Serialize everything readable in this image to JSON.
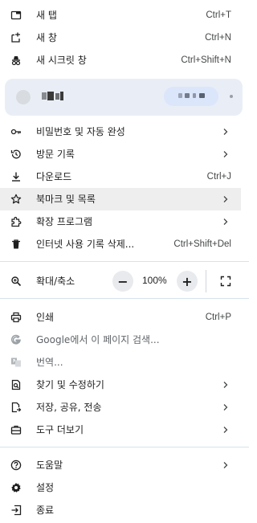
{
  "menu": {
    "new_tab": {
      "label": "새 탭",
      "shortcut": "Ctrl+T",
      "icon": "new-tab-icon"
    },
    "new_window": {
      "label": "새 창",
      "shortcut": "Ctrl+N",
      "icon": "new-window-icon"
    },
    "new_incognito": {
      "label": "새 시크릿 창",
      "shortcut": "Ctrl+Shift+N",
      "icon": "incognito-icon"
    },
    "passwords": {
      "label": "비밀번호 및 자동 완성",
      "icon": "key-icon"
    },
    "history": {
      "label": "방문 기록",
      "icon": "history-icon"
    },
    "downloads": {
      "label": "다운로드",
      "shortcut": "Ctrl+J",
      "icon": "download-icon"
    },
    "bookmarks": {
      "label": "북마크 및 목록",
      "icon": "star-icon"
    },
    "extensions": {
      "label": "확장 프로그램",
      "icon": "puzzle-icon"
    },
    "clear_data": {
      "label": "인터넷 사용 기록 삭제...",
      "shortcut": "Ctrl+Shift+Del",
      "icon": "trash-icon"
    },
    "zoom": {
      "label": "확대/축소",
      "value": "100%",
      "minus": "−",
      "plus": "+",
      "icon": "zoom-icon"
    },
    "print": {
      "label": "인쇄",
      "shortcut": "Ctrl+P",
      "icon": "print-icon"
    },
    "google_search": {
      "label": "Google에서 이 페이지 검색...",
      "icon": "google-icon"
    },
    "translate": {
      "label": "번역...",
      "icon": "translate-icon"
    },
    "find_edit": {
      "label": "찾기 및 수정하기",
      "icon": "find-icon"
    },
    "save_share": {
      "label": "저장, 공유, 전송",
      "icon": "save-share-icon"
    },
    "more_tools": {
      "label": "도구 더보기",
      "icon": "toolbox-icon"
    },
    "help": {
      "label": "도움말",
      "icon": "help-icon"
    },
    "settings": {
      "label": "설정",
      "icon": "gear-icon"
    },
    "exit": {
      "label": "종료",
      "icon": "exit-icon"
    }
  },
  "colors": {
    "profile_bg": "#e9eef6",
    "highlight_bg": "#eeeeee",
    "separator": "#d5e3ec",
    "text": "#1f1f1f",
    "muted": "#5f6368"
  }
}
